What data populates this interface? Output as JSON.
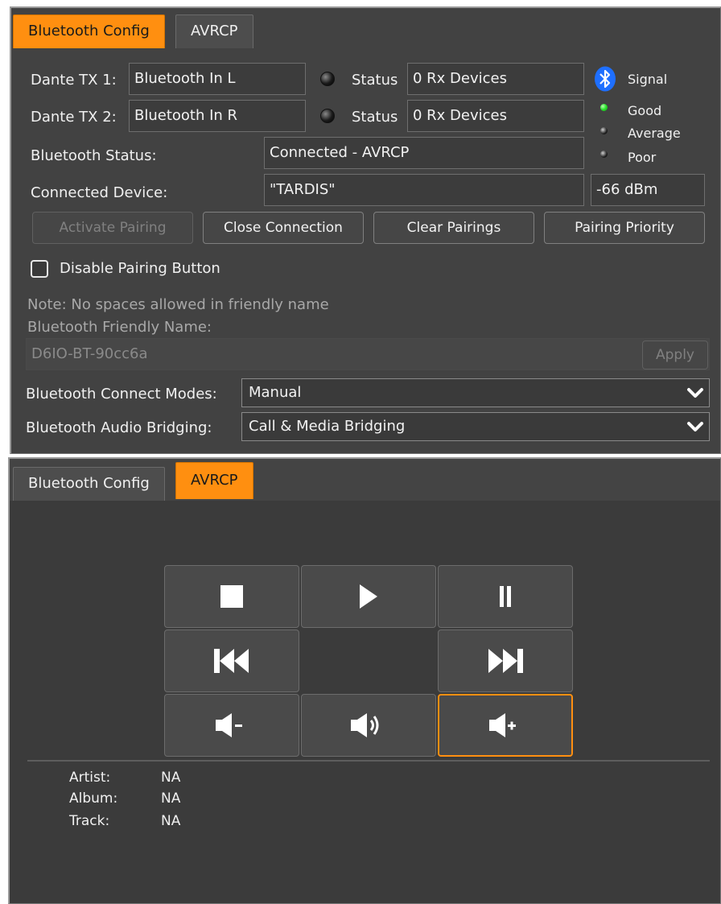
{
  "top_panel": {
    "tabs": [
      {
        "label": "Bluetooth Config",
        "active": true
      },
      {
        "label": "AVRCP",
        "active": false
      }
    ],
    "tx1": {
      "label": "Dante TX 1:",
      "value": "Bluetooth In L",
      "status_label": "Status",
      "status_value": "0 Rx Devices"
    },
    "tx2": {
      "label": "Dante TX 2:",
      "value": "Bluetooth In R",
      "status_label": "Status",
      "status_value": "0 Rx Devices"
    },
    "signal": {
      "icon": "bluetooth-icon",
      "title": "Signal",
      "good": "Good",
      "average": "Average",
      "poor": "Poor",
      "level": "Good",
      "dbm": "-66 dBm"
    },
    "bt_status": {
      "label": "Bluetooth Status:",
      "value": "Connected - AVRCP"
    },
    "connected_device": {
      "label": "Connected Device:",
      "value": "\"TARDIS\""
    },
    "buttons": {
      "activate": "Activate Pairing",
      "close": "Close Connection",
      "clear": "Clear Pairings",
      "priority": "Pairing Priority"
    },
    "disable_pairing": {
      "label": "Disable Pairing Button",
      "checked": false
    },
    "note": "Note: No spaces allowed in friendly name",
    "friendly_label": "Bluetooth Friendly Name:",
    "friendly_value": "D6IO-BT-90cc6a",
    "apply": "Apply",
    "connect_modes": {
      "label": "Bluetooth Connect Modes:",
      "value": "Manual"
    },
    "audio_bridging": {
      "label": "Bluetooth Audio Bridging:",
      "value": "Call & Media Bridging"
    }
  },
  "bottom_panel": {
    "tabs": [
      {
        "label": "Bluetooth Config",
        "active": false
      },
      {
        "label": "AVRCP",
        "active": true
      }
    ],
    "controls": [
      "stop-icon",
      "play-icon",
      "pause-icon",
      "previous-track-icon",
      "next-track-icon",
      "volume-down-icon",
      "volume-icon",
      "volume-up-icon"
    ],
    "meta": {
      "artist_label": "Artist:",
      "artist": "NA",
      "album_label": "Album:",
      "album": "NA",
      "track_label": "Track:",
      "track": "NA"
    }
  },
  "colors": {
    "accent": "#ff8f10",
    "panel": "#424242",
    "led_good": "#27e02a",
    "bluetooth": "#1e6fff"
  }
}
